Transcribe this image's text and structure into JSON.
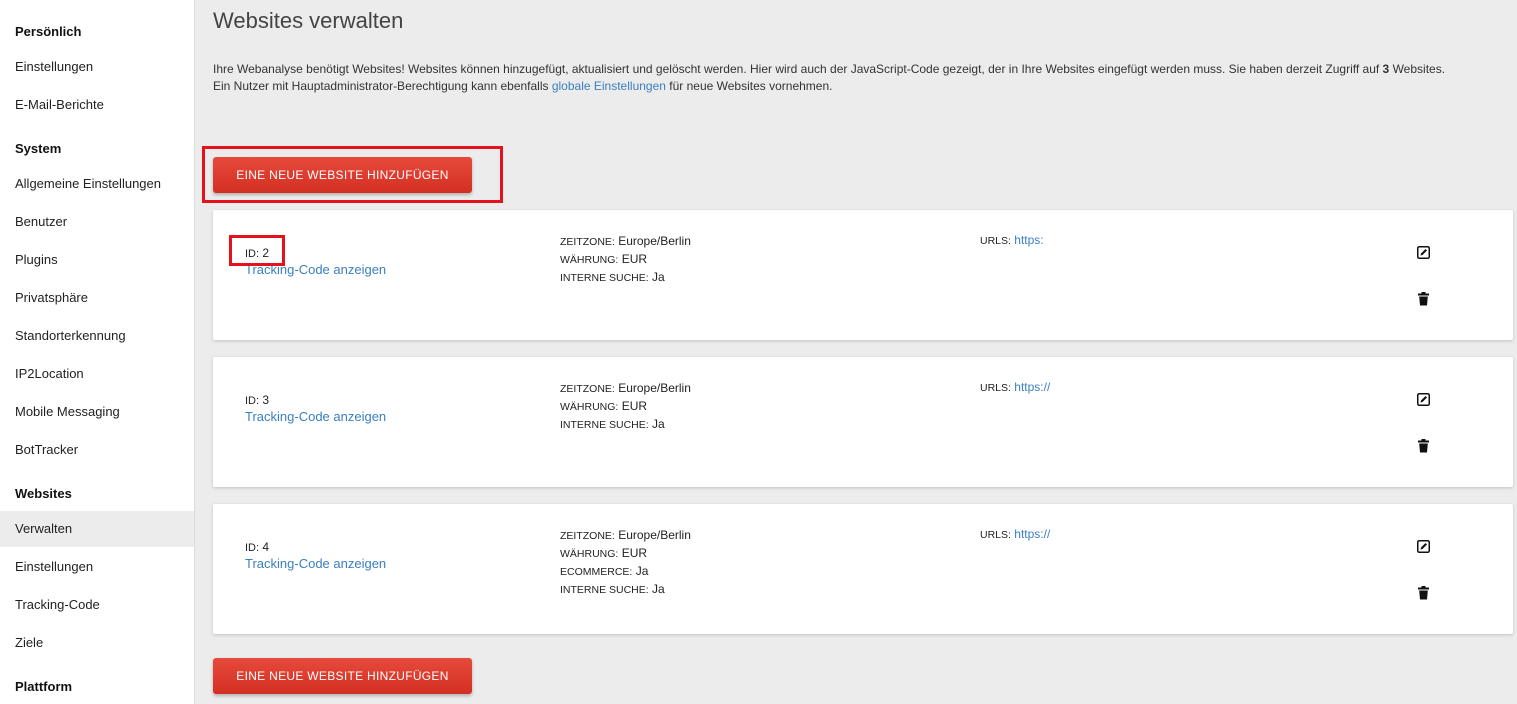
{
  "sidebar": {
    "sections": [
      {
        "heading": "Persönlich",
        "items": [
          "Einstellungen",
          "E-Mail-Berichte"
        ]
      },
      {
        "heading": "System",
        "items": [
          "Allgemeine Einstellungen",
          "Benutzer",
          "Plugins",
          "Privatsphäre",
          "Standorterkennung",
          "IP2Location",
          "Mobile Messaging",
          "BotTracker"
        ]
      },
      {
        "heading": "Websites",
        "items": [
          "Verwalten",
          "Einstellungen",
          "Tracking-Code",
          "Ziele"
        ]
      },
      {
        "heading": "Plattform",
        "items": []
      }
    ],
    "active_item": "Verwalten"
  },
  "main": {
    "title": "Websites verwalten",
    "intro_line1_prefix": "Ihre Webanalyse benötigt Websites! Websites können hinzugefügt, aktualisiert und gelöscht werden. Hier wird auch der JavaScript-Code gezeigt, der in Ihre Websites eingefügt werden muss. Sie haben derzeit Zugriff auf ",
    "intro_count": "3",
    "intro_line1_suffix": " Websites.",
    "intro_line2_prefix": "Ein Nutzer mit Hauptadministrator-Berechtigung kann ebenfalls ",
    "intro_link": "globale Einstellungen",
    "intro_line2_suffix": " für neue Websites vornehmen.",
    "add_button_label": "EINE NEUE WEBSITE HINZUFÜGEN",
    "labels": {
      "id": "ID:",
      "timezone": "ZEITZONE:",
      "currency": "WÄHRUNG:",
      "ecommerce": "ECOMMERCE:",
      "internal_search": "INTERNE SUCHE:",
      "urls": "URLS:",
      "tracking_link": "Tracking-Code anzeigen"
    },
    "sites": [
      {
        "id": "2",
        "timezone": "Europe/Berlin",
        "currency": "EUR",
        "ecommerce": null,
        "internal_search": "Ja",
        "url": "https:"
      },
      {
        "id": "3",
        "timezone": "Europe/Berlin",
        "currency": "EUR",
        "ecommerce": null,
        "internal_search": "Ja",
        "url": "https://"
      },
      {
        "id": "4",
        "timezone": "Europe/Berlin",
        "currency": "EUR",
        "ecommerce": "Ja",
        "internal_search": "Ja",
        "url": "https://"
      }
    ]
  },
  "colors": {
    "accent_red": "#d32f22",
    "link_blue": "#3a7fc1",
    "highlight_red": "#e3121c"
  }
}
